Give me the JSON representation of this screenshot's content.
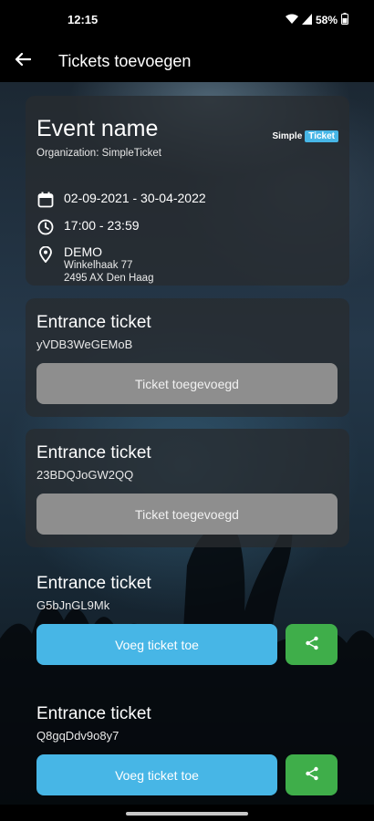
{
  "statusbar": {
    "time": "12:15",
    "battery": "58%"
  },
  "appbar": {
    "title": "Tickets toevoegen"
  },
  "event": {
    "name": "Event name",
    "organization": "Organization: SimpleTicket",
    "logo_left": "Simple",
    "logo_right": "Ticket",
    "dates": "02-09-2021 - 30-04-2022",
    "time": "17:00 - 23:59",
    "location_name": "DEMO",
    "location_street": "Winkelhaak 77",
    "location_city": "2495 AX Den Haag"
  },
  "tickets": [
    {
      "title": "Entrance ticket",
      "code": "yVDB3WeGEMoB",
      "button": "Ticket toegevoegd",
      "state": "added"
    },
    {
      "title": "Entrance ticket",
      "code": "23BDQJoGW2QQ",
      "button": "Ticket toegevoegd",
      "state": "added"
    },
    {
      "title": "Entrance ticket",
      "code": "G5bJnGL9Mk",
      "button": "Voeg ticket toe",
      "state": "pending"
    },
    {
      "title": "Entrance ticket",
      "code": "Q8gqDdv9o8y7",
      "button": "Voeg ticket toe",
      "state": "pending"
    }
  ],
  "colors": {
    "accent_blue": "#47b6e6",
    "share_green": "#3fae4a",
    "added_grey": "#8e8e8e"
  },
  "icons": [
    "back-arrow-icon",
    "wifi-icon",
    "signal-icon",
    "battery-icon",
    "calendar-icon",
    "clock-icon",
    "location-pin-icon",
    "share-icon"
  ]
}
